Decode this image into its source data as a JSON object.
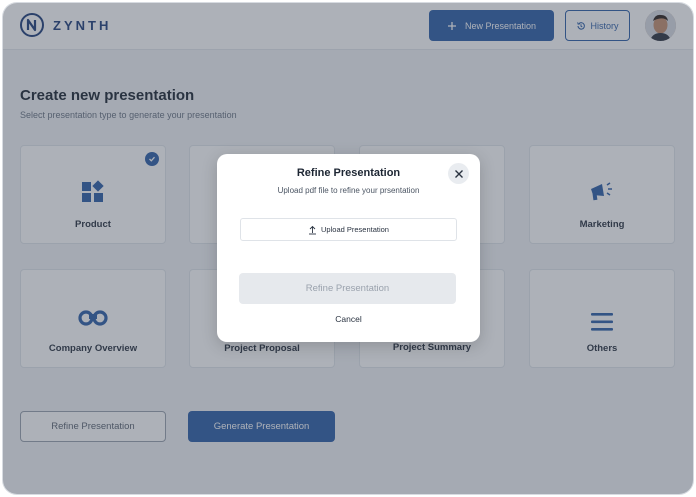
{
  "brand": {
    "name": "ZYNTH"
  },
  "header": {
    "new_label": "New Presentation",
    "history_label": "History"
  },
  "page": {
    "title": "Create new presentation",
    "subtitle": "Select presentation type to generate your presentation"
  },
  "cards": [
    {
      "label": "Product",
      "icon": "product-icon",
      "selected": true
    },
    {
      "label": "",
      "icon": "",
      "selected": false
    },
    {
      "label": "",
      "icon": "",
      "selected": false
    },
    {
      "label": "Marketing",
      "icon": "megaphone-icon",
      "selected": false
    },
    {
      "label": "Company Overview",
      "icon": "binoculars-icon",
      "selected": false
    },
    {
      "label": "Project Proposal",
      "icon": "",
      "selected": false
    },
    {
      "label": "Project Summary",
      "icon": "",
      "selected": false
    },
    {
      "label": "Others",
      "icon": "menu-icon",
      "selected": false
    }
  ],
  "footer": {
    "refine_label": "Refine Presentation",
    "generate_label": "Generate Presentation"
  },
  "modal": {
    "title": "Refine Presentation",
    "subtitle": "Upload pdf file to refine your prsentation",
    "upload_label": "Upload Presentation",
    "refine_label": "Refine Presentation",
    "cancel_label": "Cancel"
  },
  "colors": {
    "accent": "#2e5fa8",
    "brand": "#1f3f7a",
    "overlay": "#3c4656"
  }
}
